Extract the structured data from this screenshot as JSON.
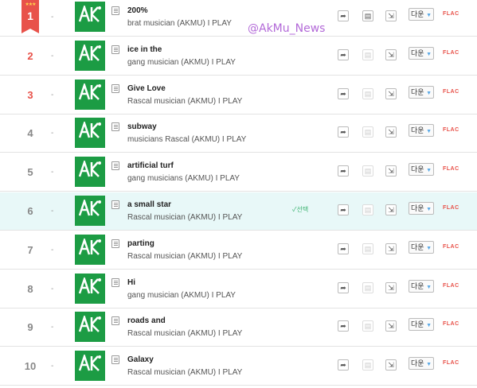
{
  "watermark": "@AkMu_News",
  "labels": {
    "select": "✓선택",
    "download": "다운",
    "flac": "FLAC",
    "stars": "★★★"
  },
  "songs": [
    {
      "rank": "1",
      "dash": "-",
      "title": "200%",
      "artist": "brat musician (AKMU) I PLAY",
      "mv": true,
      "selected": false
    },
    {
      "rank": "2",
      "dash": "-",
      "title": "ice in the",
      "artist": "gang musician (AKMU) I PLAY",
      "mv": false,
      "selected": false
    },
    {
      "rank": "3",
      "dash": "-",
      "title": "Give Love",
      "artist": "Rascal musician (AKMU) I PLAY",
      "mv": false,
      "selected": false
    },
    {
      "rank": "4",
      "dash": "-",
      "title": "subway",
      "artist": "musicians Rascal (AKMU) I PLAY",
      "mv": false,
      "selected": false
    },
    {
      "rank": "5",
      "dash": "-",
      "title": "artificial turf",
      "artist": "gang musicians (AKMU) I PLAY",
      "mv": false,
      "selected": false
    },
    {
      "rank": "6",
      "dash": "-",
      "title": "a small star",
      "artist": "Rascal musician (AKMU) I PLAY",
      "mv": false,
      "selected": true
    },
    {
      "rank": "7",
      "dash": "-",
      "title": "parting",
      "artist": "Rascal musician (AKMU) I PLAY",
      "mv": false,
      "selected": false
    },
    {
      "rank": "8",
      "dash": "-",
      "title": "Hi",
      "artist": "gang musician (AKMU) I PLAY",
      "mv": false,
      "selected": false
    },
    {
      "rank": "9",
      "dash": "-",
      "title": "roads and",
      "artist": "Rascal musician (AKMU) I PLAY",
      "mv": false,
      "selected": false
    },
    {
      "rank": "10",
      "dash": "-",
      "title": "Galaxy",
      "artist": "Rascal musician (AKMU) I PLAY",
      "mv": false,
      "selected": false
    }
  ]
}
